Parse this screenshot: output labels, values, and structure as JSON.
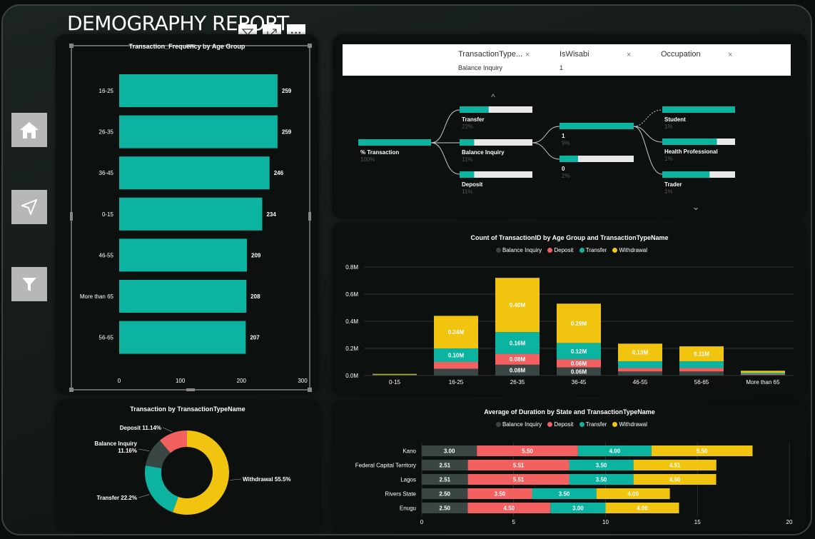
{
  "report_title": "DEMOGRAPHY REPORT",
  "colors": {
    "teal": "#0bb3a0",
    "yellow": "#f1c40f",
    "red": "#f26060",
    "dark": "#3a4643"
  },
  "nav": {
    "icons": [
      "home-icon",
      "navigate-icon",
      "filter-icon"
    ]
  },
  "visual_header": {
    "icons": [
      "filter-icon",
      "focus-mode-icon",
      "more-options-icon"
    ],
    "more_label": "···"
  },
  "age_bar": {
    "title": "Transaction_Frequency by Age Group",
    "chart_data": {
      "type": "bar",
      "orientation": "horizontal",
      "title": "Transaction_Frequency by Age Group",
      "categories": [
        "16-25",
        "26-35",
        "36-45",
        "0-15",
        "46-55",
        "More than 65",
        "56-65"
      ],
      "values": [
        259,
        259,
        246,
        234,
        209,
        208,
        207
      ],
      "xlim": [
        0,
        300
      ],
      "xticks": [
        0,
        100,
        200,
        300
      ]
    }
  },
  "decomp": {
    "filters": [
      {
        "header": "TransactionType...",
        "value": "Balance Inquiry"
      },
      {
        "header": "IsWisabi",
        "value": "1"
      },
      {
        "header": "Occupation",
        "value": ""
      }
    ],
    "close_glyph": "×",
    "up_glyph": "^",
    "down_glyph": "⌄",
    "root": {
      "label": "% Transaction",
      "pct": "100%",
      "fill": 1.0
    },
    "level1": [
      {
        "label": "Transfer",
        "pct": "22%",
        "fill": 0.4
      },
      {
        "label": "Balance Inquiry",
        "pct": "11%",
        "fill": 0.2
      },
      {
        "label": "Deposit",
        "pct": "11%",
        "fill": 0.2
      }
    ],
    "level2": [
      {
        "label": "1",
        "pct": "9%",
        "fill": 1.0
      },
      {
        "label": "0",
        "pct": "2%",
        "fill": 0.25
      }
    ],
    "level3": [
      {
        "label": "Student",
        "pct": "1%",
        "fill": 1.0
      },
      {
        "label": "Health Professional",
        "pct": "1%",
        "fill": 0.75
      },
      {
        "label": "Trader",
        "pct": "1%",
        "fill": 0.65
      }
    ]
  },
  "stacked": {
    "title": "Count of TransactionID by Age Group and TransactionTypeName",
    "legend": [
      "Balance Inquiry",
      "Deposit",
      "Transfer",
      "Withdrawal"
    ],
    "chart_data": {
      "type": "bar",
      "stacked": true,
      "title": "Count of TransactionID by Age Group and TransactionTypeName",
      "categories": [
        "0-15",
        "16-25",
        "26-35",
        "36-45",
        "46-55",
        "56-65",
        "More than 65"
      ],
      "series": [
        {
          "name": "Balance Inquiry",
          "values": [
            0.002,
            0.05,
            0.08,
            0.06,
            0.03,
            0.03,
            0.005
          ],
          "labels": [
            "",
            "",
            "0.08M",
            "0.06M",
            "",
            "",
            ""
          ]
        },
        {
          "name": "Deposit",
          "values": [
            0.002,
            0.05,
            0.08,
            0.06,
            0.025,
            0.025,
            0.005
          ],
          "labels": [
            "",
            "",
            "0.08M",
            "0.06M",
            "",
            "",
            ""
          ]
        },
        {
          "name": "Transfer",
          "values": [
            0.003,
            0.1,
            0.16,
            0.12,
            0.05,
            0.05,
            0.01
          ],
          "labels": [
            "",
            "0.10M",
            "0.16M",
            "0.12M",
            "",
            "",
            ""
          ]
        },
        {
          "name": "Withdrawal",
          "values": [
            0.005,
            0.24,
            0.4,
            0.29,
            0.13,
            0.11,
            0.015
          ],
          "labels": [
            "",
            "0.24M",
            "0.40M",
            "0.29M",
            "0.13M",
            "0.11M",
            ""
          ]
        }
      ],
      "ylim": [
        0,
        0.8
      ],
      "yticks": [
        "0.0M",
        "0.2M",
        "0.4M",
        "0.6M",
        "0.8M"
      ]
    }
  },
  "donut": {
    "title": "Transaction by TransactionTypeName",
    "chart_data": {
      "type": "pie",
      "title": "Transaction by TransactionTypeName",
      "slices": [
        {
          "name": "Withdrawal",
          "value": 55.5,
          "label": "Withdrawal 55.5%"
        },
        {
          "name": "Transfer",
          "value": 22.2,
          "label": "Transfer 22.2%"
        },
        {
          "name": "Balance Inquiry",
          "value": 11.16,
          "label": "Balance Inquiry 11.16%"
        },
        {
          "name": "Deposit",
          "value": 11.14,
          "label": "Deposit 11.14%"
        }
      ]
    }
  },
  "duration": {
    "title": "Average of Duration by State and TransactionTypeName",
    "legend": [
      "Balance Inquiry",
      "Deposit",
      "Transfer",
      "Withdrawal"
    ],
    "chart_data": {
      "type": "bar",
      "orientation": "horizontal",
      "stacked": true,
      "title": "Average of Duration by State and TransactionTypeName",
      "categories": [
        "Kano",
        "Federal Capital Territory",
        "Lagos",
        "Rivers State",
        "Enugu"
      ],
      "series": [
        {
          "name": "Balance Inquiry",
          "values": [
            3.0,
            2.51,
            2.51,
            2.5,
            2.5
          ],
          "labels": [
            "3.00",
            "2.51",
            "2.51",
            "2.50",
            "2.50"
          ]
        },
        {
          "name": "Deposit",
          "values": [
            5.5,
            5.51,
            5.51,
            3.5,
            4.5
          ],
          "labels": [
            "5.50",
            "5.51",
            "5.51",
            "3.50",
            "4.50"
          ]
        },
        {
          "name": "Transfer",
          "values": [
            4.0,
            3.5,
            3.5,
            3.5,
            3.0
          ],
          "labels": [
            "4.00",
            "3.50",
            "3.50",
            "3.50",
            "3.00"
          ]
        },
        {
          "name": "Withdrawal",
          "values": [
            5.5,
            4.51,
            4.5,
            4.0,
            4.0
          ],
          "labels": [
            "5.50",
            "4.51",
            "4.50",
            "4.00",
            "4.00"
          ]
        }
      ],
      "xlim": [
        0,
        20
      ],
      "xticks": [
        0,
        5,
        10,
        15,
        20
      ]
    }
  }
}
